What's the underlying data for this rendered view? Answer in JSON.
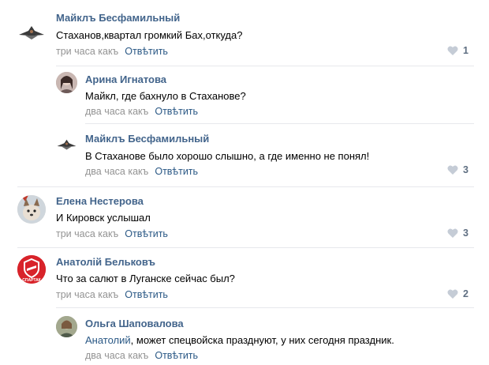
{
  "comments": [
    {
      "author": "Майклъ Бесфамильный",
      "text": "Стаханов,квартал громкий Бах,откуда?",
      "time": "три часа какъ",
      "reply": "Отвѣтить",
      "likes": "1",
      "avatar_icon": "plane-icon"
    },
    {
      "author": "Арина Игнатова",
      "text": "Майкл, где бахнуло в Стаханове?",
      "time": "два часа какъ",
      "reply": "Отвѣтить",
      "likes": "",
      "avatar_icon": "photo-avatar"
    },
    {
      "author": "Майклъ Бесфамильный",
      "text": "В Стаханове было хорошо слышно, а где именно не понял!",
      "time": "два часа какъ",
      "reply": "Отвѣтить",
      "likes": "3",
      "avatar_icon": "plane-icon"
    },
    {
      "author": "Елена Нестерова",
      "text": "И Кировск услышал",
      "time": "три часа какъ",
      "reply": "Отвѣтить",
      "likes": "3",
      "avatar_icon": "dog-photo-avatar"
    },
    {
      "author": "Анатолій Бельковъ",
      "text": "Что за салют в Луганске сейчас был?",
      "time": "три часа какъ",
      "reply": "Отвѣтить",
      "likes": "2",
      "avatar_icon": "spartak-logo",
      "avatar_text": "СПАРТАК"
    },
    {
      "author": "Ольга Шаповалова",
      "mention": "Анатолий",
      "text": ", может спецвойска празднуют, у них сегодня праздник.",
      "time": "два часа какъ",
      "reply": "Отвѣтить",
      "likes": "",
      "avatar_icon": "photo-avatar"
    }
  ]
}
